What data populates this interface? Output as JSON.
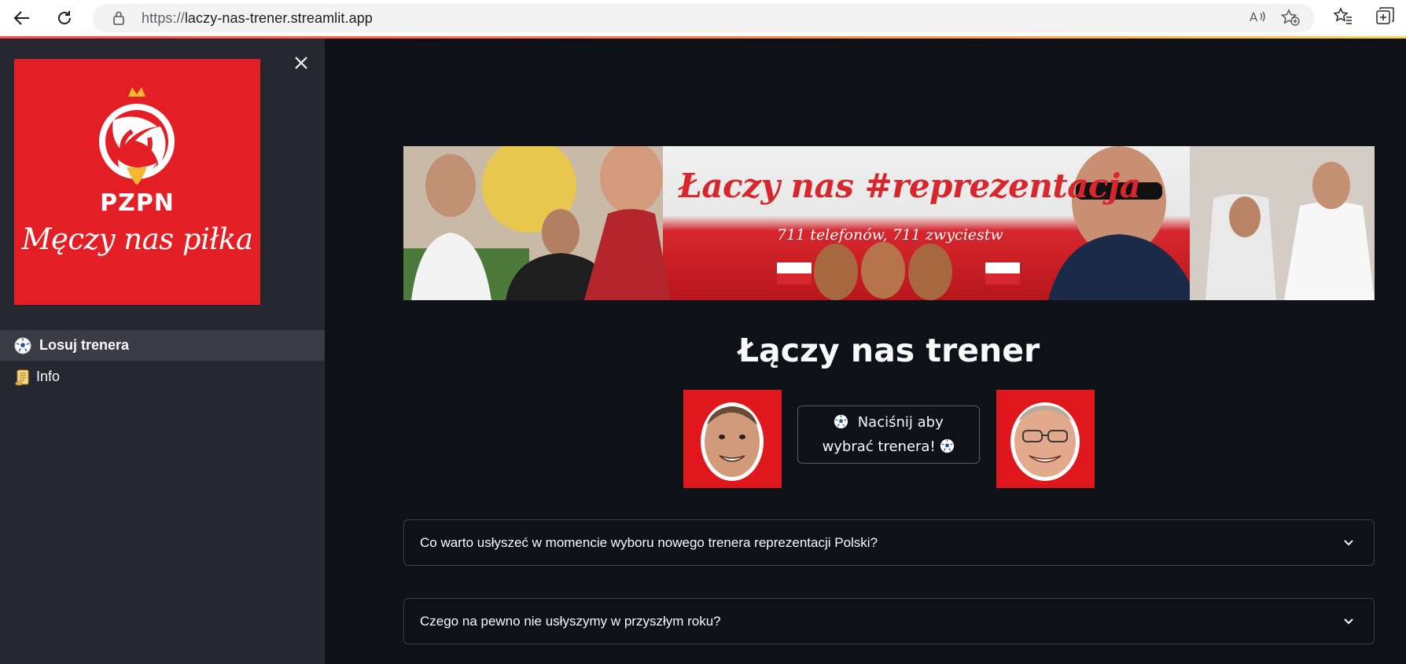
{
  "browser": {
    "url_prefix": "https://",
    "url_host": "laczy-nas-trener.streamlit.app",
    "icons": [
      "back-arrow-icon",
      "reload-icon",
      "lock-icon",
      "read-aloud-icon",
      "add-favorite-icon",
      "favorites-icon",
      "collections-icon"
    ]
  },
  "sidebar": {
    "logo": {
      "badge_text": "PZPN",
      "slogan": "Męczy nas piłka",
      "background": "#e31e24"
    },
    "items": [
      {
        "label": "Losuj trenera",
        "icon": "soccer-ball-icon",
        "active": true
      },
      {
        "label": "Info",
        "icon": "scroll-icon",
        "active": false
      }
    ]
  },
  "main": {
    "banner": {
      "title": "Łaczy nas #reprezentacja",
      "subtitle": "711 telefonów, 711 zwyciestw"
    },
    "title": "Łączy nas trener",
    "pick_button": {
      "label": "Naciśnij aby wybrać trenera!"
    },
    "expanders": [
      {
        "question": "Co warto usłyszeć w momencie wyboru nowego trenera reprezentacji Polski?"
      },
      {
        "question": "Czego na pewno nie usłyszymy w przyszłym roku?"
      }
    ]
  },
  "colors": {
    "app_bg": "#0e1117",
    "sidebar_bg": "#262730",
    "accent_red": "#e31e24",
    "text": "#fafafa"
  }
}
